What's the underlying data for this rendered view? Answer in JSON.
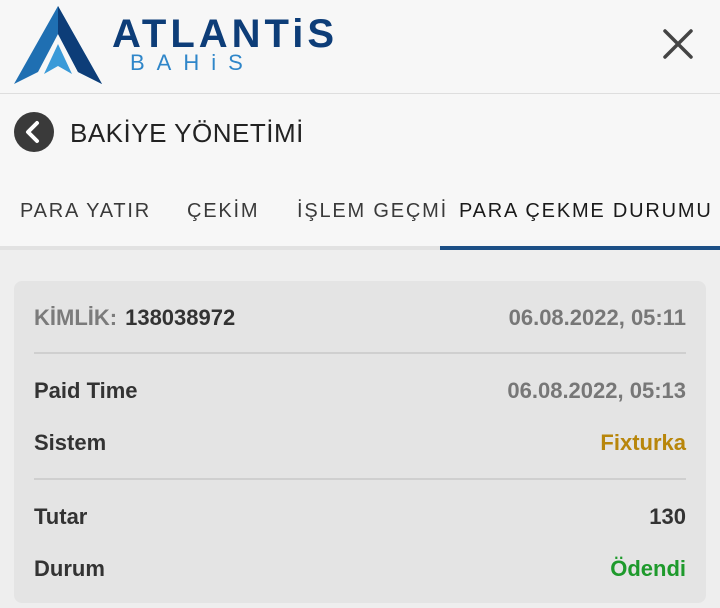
{
  "header": {
    "logo_title": "ATLANTiS",
    "logo_subtitle": "BAHiS",
    "colors": {
      "logo_dark": "#0d3d78",
      "logo_light": "#2f86c9"
    }
  },
  "title_bar": {
    "title": "BAKİYE YÖNETİMİ"
  },
  "tabs": [
    {
      "label": "PARA YATIR",
      "active": false
    },
    {
      "label": "ÇEKİM",
      "active": false
    },
    {
      "label": "İŞLEM GEÇMİ",
      "active": false
    },
    {
      "label": "PARA ÇEKME DURUMU",
      "active": true
    }
  ],
  "accent_color": "#1c4f86",
  "transaction": {
    "id_label": "KİMLİK:",
    "id_value": "138038972",
    "created": "06.08.2022, 05:11",
    "paid_time_label": "Paid Time",
    "paid_time_value": "06.08.2022, 05:13",
    "system_label": "Sistem",
    "system_value": "Fixturka",
    "system_color": "#b8860b",
    "amount_label": "Tutar",
    "amount_value": "130",
    "status_label": "Durum",
    "status_value": "Ödendi",
    "status_color": "#1e9a2c"
  }
}
